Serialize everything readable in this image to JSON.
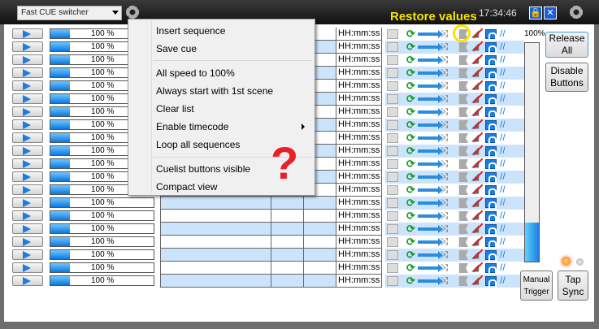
{
  "header": {
    "selector_value": "Fast CUE switcher",
    "clock": "17:34:46",
    "annotation": "Restore values",
    "lock_icon": "lock-icon",
    "close_icon": "close-icon"
  },
  "menu": {
    "items": [
      "Insert sequence",
      "Save cue",
      "All speed to 100%",
      "Always start with 1st scene",
      "Clear list",
      "Enable timecode",
      "Loop all sequences",
      "Cuelist buttons visible",
      "Compact view"
    ]
  },
  "annotation_mark": "?",
  "rows": {
    "count": 20,
    "speed_label": "100 %",
    "speed_fraction": 0.19,
    "time_placeholder": "HH:mm:ss"
  },
  "right": {
    "master_label": "100%",
    "master_fraction": 0.18,
    "release_all": "Release All",
    "disable_buttons": "Disable Buttons",
    "manual_trigger": "Manual Trigger",
    "tap_sync": "Tap Sync"
  },
  "colors": {
    "accent": "#1b7de0",
    "row_alt": "#cce4fb",
    "annotation": "#f5e600",
    "mark": "#e8202a"
  }
}
